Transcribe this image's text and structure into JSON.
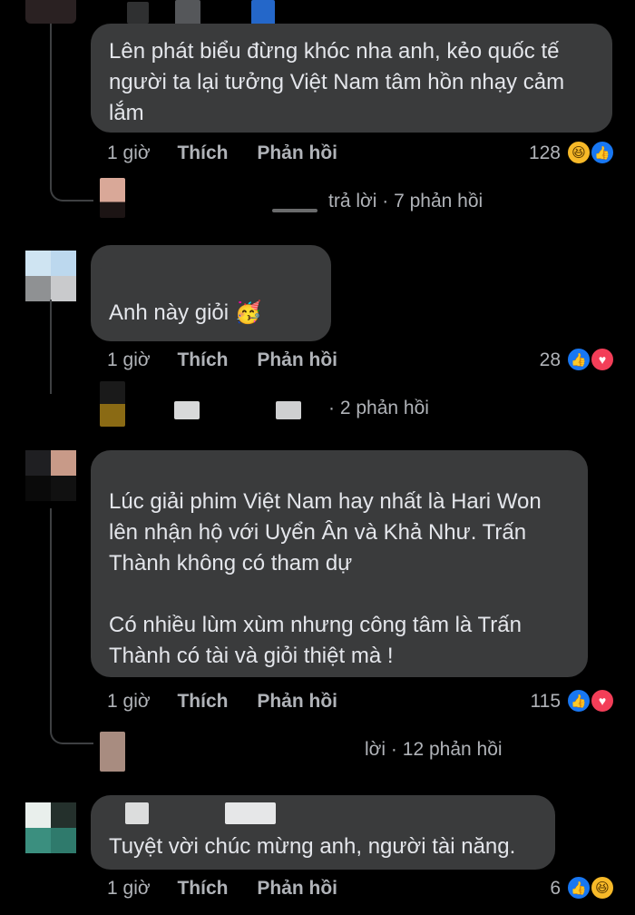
{
  "comments": [
    {
      "text_lines": [
        "Lên phát biểu đừng khóc nha anh, kẻo quốc tế",
        "người ta lại tưởng Việt Nam tâm hồn nhạy cảm",
        "lắm"
      ],
      "time": "1 giờ",
      "like_label": "Thích",
      "reply_label": "Phản hồi",
      "reaction_count": "128",
      "reactions": [
        "haha-icon",
        "like-icon"
      ],
      "replies_text": "trả lời · 7 phản hồi"
    },
    {
      "text": "Anh này giỏi 🥳",
      "time": "1 giờ",
      "like_label": "Thích",
      "reply_label": "Phản hồi",
      "reaction_count": "28",
      "reactions": [
        "like-icon",
        "love-icon"
      ],
      "replies_text": "· 2 phản hồi"
    },
    {
      "text_lines": [
        "Lúc giải phim Việt Nam hay nhất là Hari Won",
        "lên nhận hộ  với Uyển Ân và Khả Như. Trấn",
        "Thành không có tham dự"
      ],
      "text_lines_2": [
        "Có nhiều lùm xùm nhưng công tâm là Trấn",
        "Thành có tài và giỏi thiệt mà !"
      ],
      "time": "1 giờ",
      "like_label": "Thích",
      "reply_label": "Phản hồi",
      "reaction_count": "115",
      "reactions": [
        "like-icon",
        "love-icon"
      ],
      "replies_text": "lời · 12 phản hồi"
    },
    {
      "text": "Tuyệt vời chúc mừng anh, người tài năng.",
      "time": "1 giờ",
      "like_label": "Thích",
      "reply_label": "Phản hồi",
      "reaction_count": "6",
      "reactions": [
        "like-icon",
        "haha-icon"
      ]
    }
  ],
  "colors": {
    "background": "#000000",
    "bubble": "#3a3b3c",
    "text": "#e4e6eb",
    "meta": "#b0b3b8",
    "like": "#1877f2",
    "love": "#f33e58",
    "haha": "#f7b928"
  }
}
